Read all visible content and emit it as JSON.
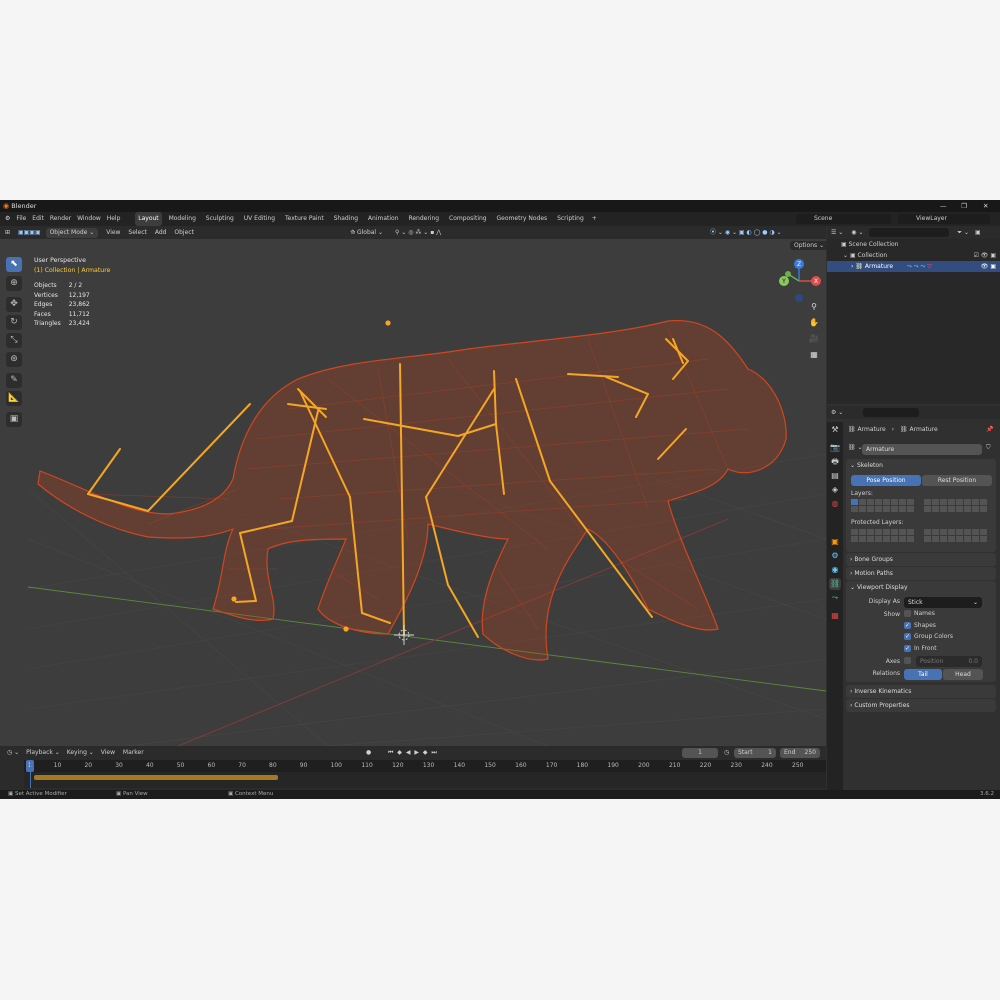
{
  "app": {
    "title": "Blender",
    "version": "3.6.2"
  },
  "menu": [
    "File",
    "Edit",
    "Render",
    "Window",
    "Help"
  ],
  "workspaces": [
    "Layout",
    "Modeling",
    "Sculpting",
    "UV Editing",
    "Texture Paint",
    "Shading",
    "Animation",
    "Rendering",
    "Compositing",
    "Geometry Nodes",
    "Scripting"
  ],
  "active_workspace": "Layout",
  "scene": {
    "name": "Scene",
    "view_layer": "ViewLayer"
  },
  "header3d": {
    "mode": "Object Mode",
    "menus": [
      "View",
      "Select",
      "Add",
      "Object"
    ],
    "transform": "Global",
    "options": "Options"
  },
  "viewport": {
    "perspective": "User Perspective",
    "context": "(1) Collection | Armature",
    "stats": [
      {
        "label": "Objects",
        "value": "2 / 2"
      },
      {
        "label": "Vertices",
        "value": "12,197"
      },
      {
        "label": "Edges",
        "value": "23,862"
      },
      {
        "label": "Faces",
        "value": "11,712"
      },
      {
        "label": "Triangles",
        "value": "23,424"
      }
    ],
    "gizmo": {
      "x": "X",
      "y": "Y",
      "z": "Z"
    }
  },
  "timeline": {
    "menus": [
      "Playback",
      "Keying",
      "View",
      "Marker"
    ],
    "current_frame": "1",
    "start_label": "Start",
    "start": "1",
    "end_label": "End",
    "end": "250",
    "ticks": [
      "1",
      "10",
      "20",
      "30",
      "40",
      "50",
      "60",
      "70",
      "80",
      "90",
      "100",
      "110",
      "120",
      "130",
      "140",
      "150",
      "160",
      "170",
      "180",
      "190",
      "200",
      "210",
      "220",
      "230",
      "240",
      "250"
    ]
  },
  "status": {
    "left": "Set Active Modifier",
    "middle": "Pan View",
    "right": "Context Menu"
  },
  "outliner": {
    "root": "Scene Collection",
    "collection": "Collection",
    "object": "Armature"
  },
  "properties": {
    "breadcrumb_obj": "Armature",
    "breadcrumb_data": "Armature",
    "data_name": "Armature",
    "skeleton": {
      "title": "Skeleton",
      "pose_position": "Pose Position",
      "rest_position": "Rest Position",
      "layers_label": "Layers:",
      "protected_label": "Protected Layers:"
    },
    "bone_groups": "Bone Groups",
    "motion_paths": "Motion Paths",
    "viewport_display": {
      "title": "Viewport Display",
      "display_as_label": "Display As",
      "display_as": "Stick",
      "show_label": "Show",
      "names": "Names",
      "shapes": "Shapes",
      "group_colors": "Group Colors",
      "in_front": "In Front",
      "axes_label": "Axes",
      "position_label": "Position",
      "position_value": "0.0",
      "relations_label": "Relations",
      "tail": "Tail",
      "head": "Head"
    },
    "inverse_kinematics": "Inverse Kinematics",
    "custom_properties": "Custom Properties"
  },
  "colors": {
    "accent": "#4772b3",
    "bone": "#f5a623",
    "wire": "#d2461e",
    "header_text": "#ffcc33"
  }
}
